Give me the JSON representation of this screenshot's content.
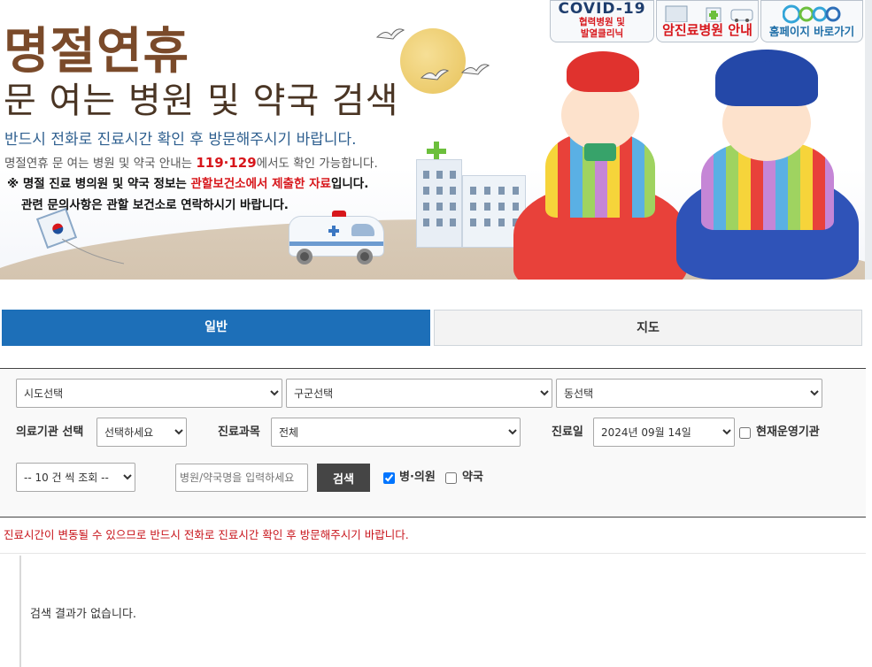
{
  "banner": {
    "title_main": "명절연휴",
    "title_sub": "문 여는 병원 및 약국 검색",
    "line1": "반드시 전화로 진료시간 확인 후 방문해주시기 바랍니다.",
    "line2_prefix": "명절연휴 문 여는 병원 및 약국 안내는 ",
    "line2_number": "119·129",
    "line2_suffix": "에서도 확인 가능합니다.",
    "line3_prefix": "※ 명절 진료 병의원 및 약국 정보는 ",
    "line3_highlight": "관할보건소에서 제출한 자료",
    "line3_suffix": "입니다.",
    "line4": "관련 문의사항은 관할 보건소로 연락하시기 바랍니다."
  },
  "top_buttons": {
    "covid_title": "COVID-19",
    "covid_sub1": "협력병원 및",
    "covid_sub2": "발열클리닉",
    "cancer_label": "암진료병원 안내",
    "homepage_label": "홈페이지 바로가기"
  },
  "tabs": {
    "general": "일반",
    "map": "지도"
  },
  "search": {
    "sido": "시도선택",
    "gugun": "구군선택",
    "dong": "동선택",
    "facility_label": "의료기관 선택",
    "facility_value": "선택하세요",
    "dept_label": "진료과목",
    "dept_value": "전체",
    "date_label": "진료일",
    "date_value": "2024년 09월 14일",
    "open_now_label": "현재운영기관",
    "page_size": "-- 10 건 씩 조회 --",
    "name_placeholder": "병원/약국명을 입력하세요",
    "search_button": "검색",
    "hospital_label": "병·의원",
    "pharmacy_label": "약국",
    "hospital_checked": true,
    "pharmacy_checked": false,
    "open_now_checked": false
  },
  "notice": "진료시간이 변동될 수 있으므로 반드시 전화로 진료시간 확인 후 방문해주시기 바랍니다.",
  "result": {
    "empty_message": "검색 결과가 없습니다."
  },
  "colors": {
    "tab_active": "#1d6fb8",
    "notice_red": "#c8141b",
    "title_brown": "#7a4a2a",
    "line_blue": "#2e5f8f"
  }
}
